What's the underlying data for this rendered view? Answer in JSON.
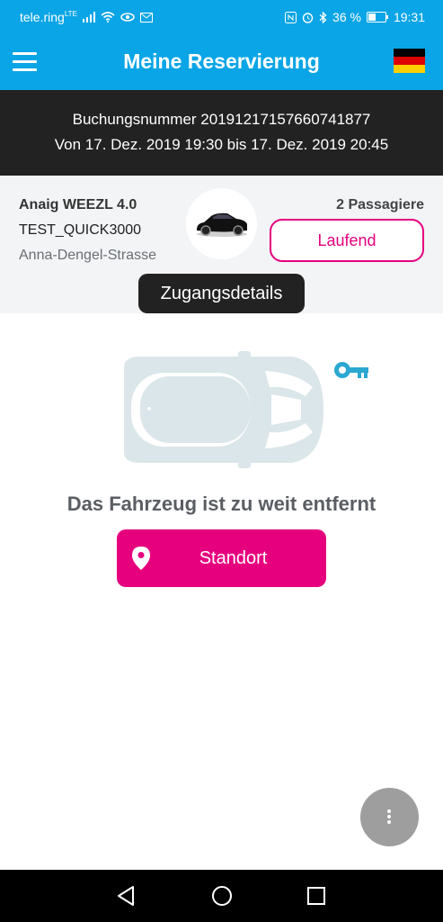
{
  "status_bar": {
    "carrier": "tele.ring",
    "network": "LTE",
    "battery": "36 %",
    "time": "19:31"
  },
  "app_bar": {
    "title": "Meine Reservierung",
    "menu_icon": "hamburger-menu-icon",
    "language_flag": "germany-flag-icon"
  },
  "booking": {
    "number_line": "Buchungsnummer 20191217157660741877",
    "period_line": "Von 17. Dez. 2019 19:30 bis 17. Dez. 2019 20:45"
  },
  "vehicle": {
    "name": "Anaig WEEZL 4.0",
    "plate": "TEST_QUICK3000",
    "address": "Anna-Dengel-Strasse",
    "passengers": "2 Passagiere",
    "status_label": "Laufend",
    "access_details": "Zugangsdetails"
  },
  "main": {
    "message": "Das Fahrzeug ist zu weit entfernt",
    "location_button": "Standort"
  },
  "colors": {
    "primary": "#0aa5e6",
    "accent": "#e6007e",
    "dark": "#222222"
  }
}
